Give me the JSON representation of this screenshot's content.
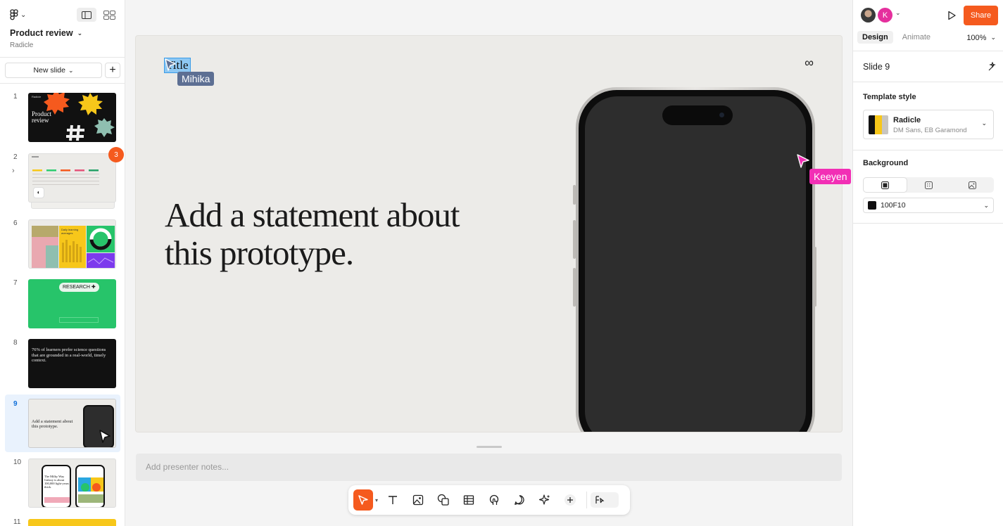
{
  "sidebar": {
    "project_title": "Product review",
    "project_subtitle": "Radicle",
    "new_slide_label": "New slide",
    "slides": [
      {
        "number": "1",
        "title_text": "Product review",
        "brand": "Radicle"
      },
      {
        "number": "2",
        "badge": "3"
      },
      {
        "number": "6",
        "chart_text": "Daily learning averages"
      },
      {
        "number": "7",
        "button_text": "RESEARCH"
      },
      {
        "number": "8",
        "quote": "76% of learners prefer science questions that are grounded in a real-world, timely context."
      },
      {
        "number": "9",
        "caption": "Add a statement about this prototype."
      },
      {
        "number": "10",
        "text": "The Milky Way Galaxy is about 100,000 light-years thick."
      },
      {
        "number": "11"
      }
    ]
  },
  "slide": {
    "title": "Title",
    "statement_line1": "Add a statement about",
    "statement_line2": "this prototype.",
    "top_right_symbol": "∞"
  },
  "cursors": {
    "mihika": "Mihika",
    "keeyen": "Keeyen"
  },
  "notes": {
    "placeholder": "Add presenter notes..."
  },
  "right_panel": {
    "avatar_initial": "K",
    "share_label": "Share",
    "tab_design": "Design",
    "tab_animate": "Animate",
    "zoom": "100%",
    "slide_name": "Slide 9",
    "template_style_label": "Template style",
    "template_name": "Radicle",
    "template_fonts": "DM Sans, EB Garamond",
    "background_label": "Background",
    "background_color_hex": "100F10"
  },
  "colors": {
    "accent": "#f55a1e",
    "keeyen_cursor": "#f22fb5",
    "mihika_cursor": "#5d6f93",
    "selected_slide": "#e9f2fd"
  }
}
